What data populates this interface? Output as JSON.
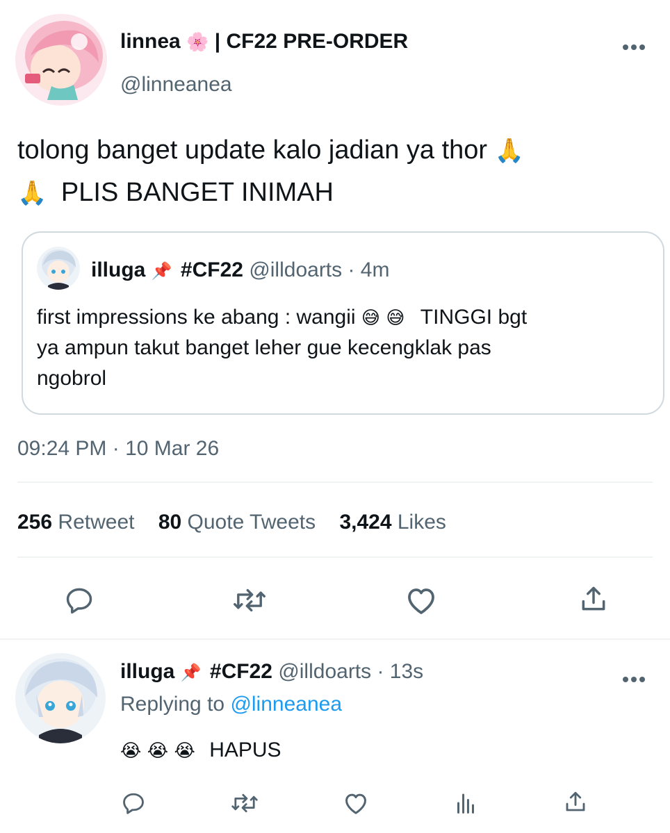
{
  "main_tweet": {
    "author_name": "linnea",
    "author_name_emoji": "🌸",
    "author_name_suffix": "| CF22 PRE-ORDER",
    "handle": "@linneanea",
    "text_line1": "tolong banget update kalo jadian ya thor",
    "emoji_pray": "🙏",
    "text_line2": "PLIS BANGET INIMAH",
    "timestamp": "09:24 PM · 10 Mar 26",
    "stats": {
      "retweets": "256",
      "retweets_label": "Retweet",
      "quotes": "80",
      "quotes_label": "Quote Tweets",
      "likes": "3,424",
      "likes_label": "Likes"
    }
  },
  "quoted_tweet": {
    "author_name": "illuga",
    "pin_emoji": "📌",
    "hashtag": "#CF22",
    "handle": "@illdoarts",
    "time": "· 4m",
    "text_line1": "first impressions ke abang : wangii",
    "emoji_sweat": "😅",
    "text_line1_end": "TINGGI bgt",
    "text_line2": "ya ampun takut banget leher gue kecengklak pas",
    "text_line3": "ngobrol"
  },
  "reply_tweet": {
    "author_name": "illuga",
    "pin_emoji": "📌",
    "hashtag": "#CF22",
    "handle": "@illdoarts",
    "time": "· 13s",
    "replying_to_label": "Replying to",
    "replying_to_handle": "@linneanea",
    "emoji_cry": "😭",
    "text": "HAPUS"
  },
  "icons": {
    "more": "more-icon",
    "reply": "reply-icon",
    "retweet": "retweet-icon",
    "like": "heart-icon",
    "share": "share-icon",
    "views": "views-icon"
  },
  "colors": {
    "text": "#0f1419",
    "muted": "#536471",
    "accent": "#1d9bf0",
    "border": "#cfd9de",
    "divider": "#eff3f4"
  }
}
